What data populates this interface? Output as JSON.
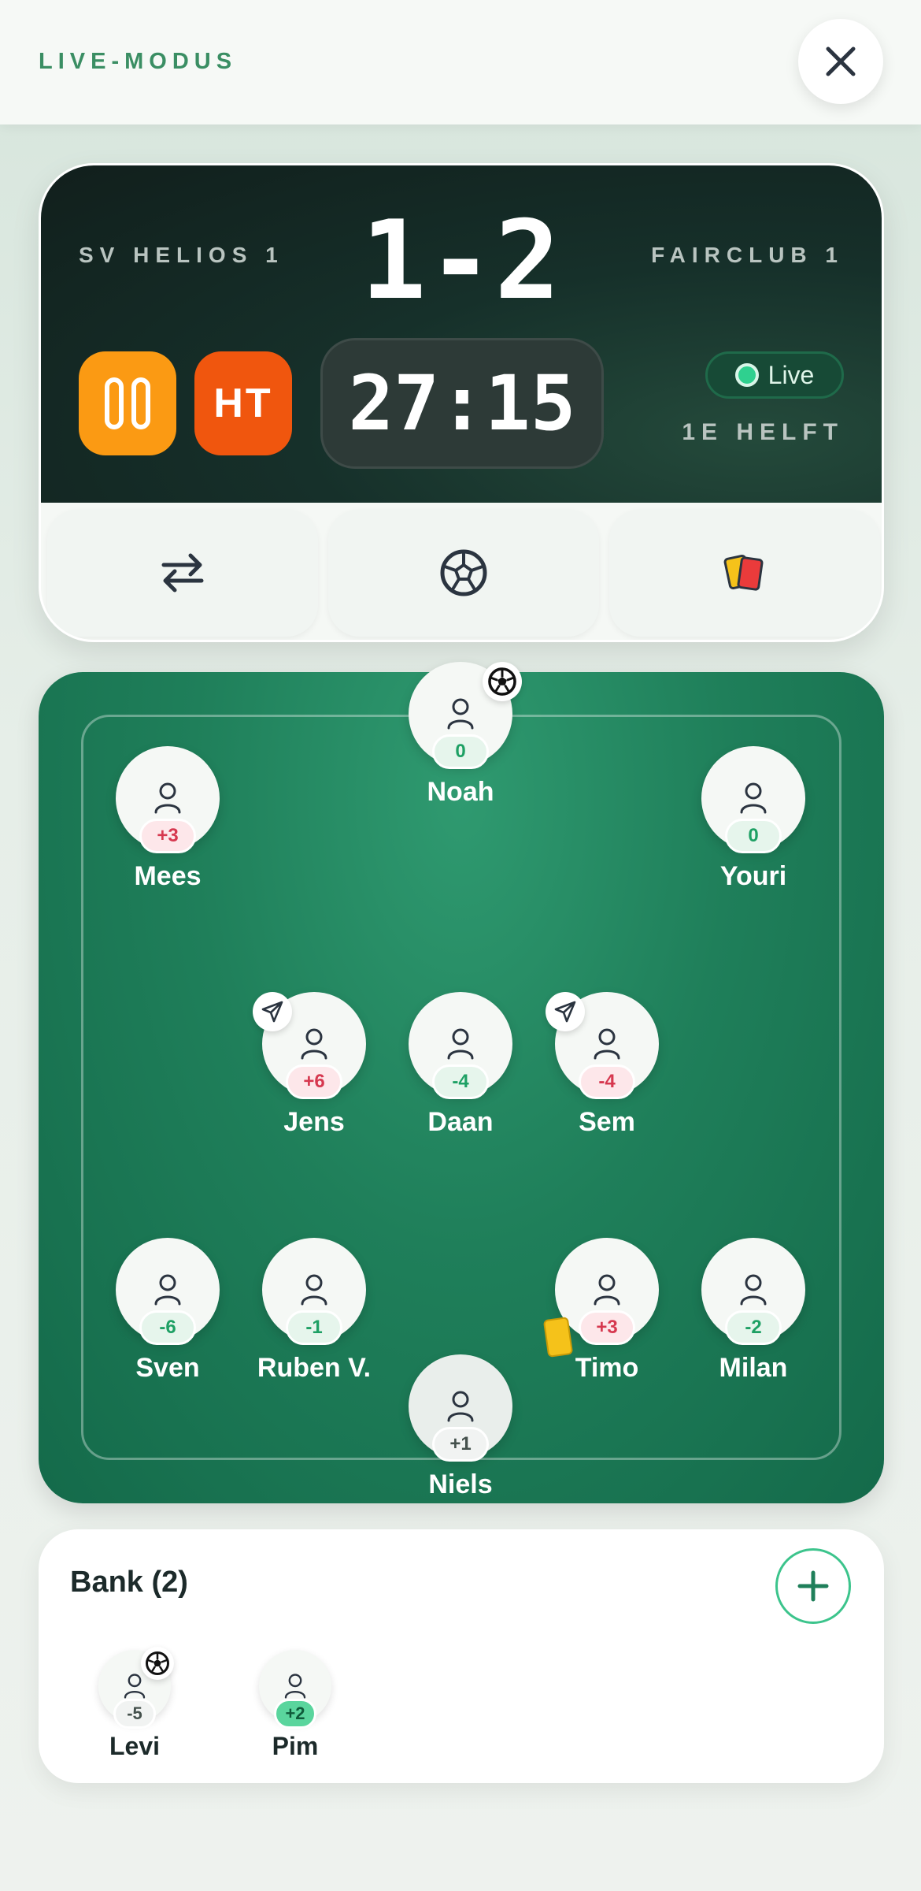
{
  "header": {
    "mode_label": "LIVE-MODUS"
  },
  "match": {
    "home_team": "SV HELIOS 1",
    "away_team": "FAIRCLUB 1",
    "score": "1-2",
    "timer": "27:15",
    "halftime_label": "HT",
    "live_label": "Live",
    "period_label": "1E HELFT"
  },
  "pitch": {
    "players": [
      {
        "name": "Noah",
        "badge": "0"
      },
      {
        "name": "Mees",
        "badge": "+3"
      },
      {
        "name": "Youri",
        "badge": "0"
      },
      {
        "name": "Jens",
        "badge": "+6"
      },
      {
        "name": "Daan",
        "badge": "-4"
      },
      {
        "name": "Sem",
        "badge": "-4"
      },
      {
        "name": "Sven",
        "badge": "-6"
      },
      {
        "name": "Ruben V.",
        "badge": "-1"
      },
      {
        "name": "Timo",
        "badge": "+3"
      },
      {
        "name": "Milan",
        "badge": "-2"
      },
      {
        "name": "Niels",
        "badge": "+1"
      }
    ]
  },
  "bench": {
    "title": "Bank (2)",
    "players": [
      {
        "name": "Levi",
        "badge": "-5"
      },
      {
        "name": "Pim",
        "badge": "+2"
      }
    ]
  },
  "icons": {
    "close": "close-icon",
    "pause": "pause-icon",
    "substitution": "swap-arrows-icon",
    "goal": "soccer-ball-icon",
    "cards": "cards-icon",
    "assist": "paper-plane-icon",
    "add": "plus-icon"
  },
  "colors": {
    "accent_green": "#3a8e63",
    "pause_orange": "#fb9a13",
    "ht_orange": "#f0560e",
    "live_green": "#2fd08f",
    "pitch_green": "#1f7f5a",
    "positive_badge": "#d6384f",
    "negative_badge": "#1ea064"
  }
}
